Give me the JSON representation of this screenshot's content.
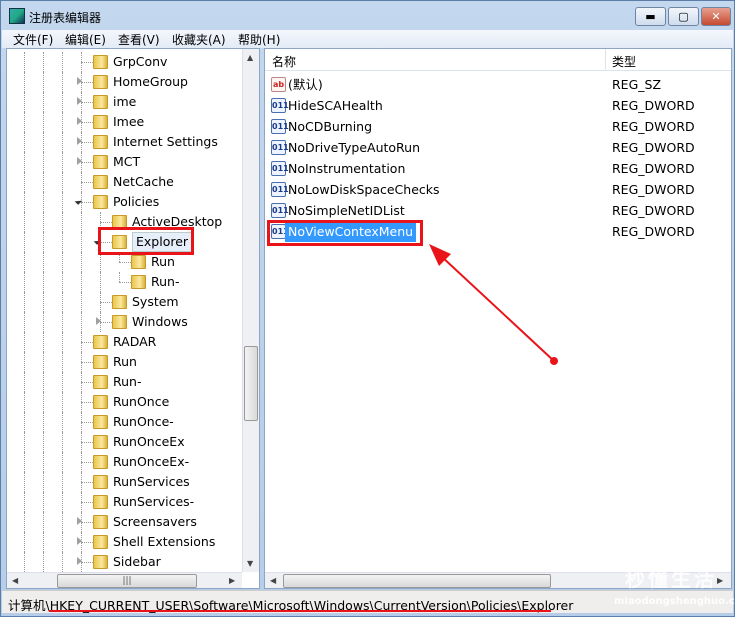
{
  "window": {
    "title": "注册表编辑器",
    "minimize": "▬",
    "maximize": "▢",
    "close": "✕"
  },
  "menu": [
    "文件(F)",
    "编辑(E)",
    "查看(V)",
    "收藏夹(A)",
    "帮助(H)"
  ],
  "tree": [
    {
      "label": "GrpConv",
      "level": 0,
      "expander": "none"
    },
    {
      "label": "HomeGroup",
      "level": 0,
      "expander": "collapsed"
    },
    {
      "label": "ime",
      "level": 0,
      "expander": "collapsed"
    },
    {
      "label": "Imee",
      "level": 0,
      "expander": "collapsed"
    },
    {
      "label": "Internet Settings",
      "level": 0,
      "expander": "collapsed"
    },
    {
      "label": "MCT",
      "level": 0,
      "expander": "collapsed"
    },
    {
      "label": "NetCache",
      "level": 0,
      "expander": "none"
    },
    {
      "label": "Policies",
      "level": 0,
      "expander": "expanded"
    },
    {
      "label": "ActiveDesktop",
      "level": 1,
      "expander": "none"
    },
    {
      "label": "Explorer",
      "level": 1,
      "expander": "expanded",
      "selected": true
    },
    {
      "label": "Run",
      "level": 2,
      "expander": "none"
    },
    {
      "label": "Run-",
      "level": 2,
      "expander": "none"
    },
    {
      "label": "System",
      "level": 1,
      "expander": "none"
    },
    {
      "label": "Windows",
      "level": 1,
      "expander": "collapsed"
    },
    {
      "label": "RADAR",
      "level": 0,
      "expander": "none"
    },
    {
      "label": "Run",
      "level": 0,
      "expander": "none"
    },
    {
      "label": "Run-",
      "level": 0,
      "expander": "none"
    },
    {
      "label": "RunOnce",
      "level": 0,
      "expander": "none"
    },
    {
      "label": "RunOnce-",
      "level": 0,
      "expander": "none"
    },
    {
      "label": "RunOnceEx",
      "level": 0,
      "expander": "none"
    },
    {
      "label": "RunOnceEx-",
      "level": 0,
      "expander": "none"
    },
    {
      "label": "RunServices",
      "level": 0,
      "expander": "none"
    },
    {
      "label": "RunServices-",
      "level": 0,
      "expander": "none"
    },
    {
      "label": "Screensavers",
      "level": 0,
      "expander": "collapsed"
    },
    {
      "label": "Shell Extensions",
      "level": 0,
      "expander": "collapsed"
    },
    {
      "label": "Sidebar",
      "level": 0,
      "expander": "collapsed"
    }
  ],
  "list": {
    "columns": {
      "name": "名称",
      "type": "类型"
    },
    "rows": [
      {
        "name": "(默认)",
        "type": "REG_SZ",
        "icon": "ab"
      },
      {
        "name": "HideSCAHealth",
        "type": "REG_DWORD",
        "icon": "binary"
      },
      {
        "name": "NoCDBurning",
        "type": "REG_DWORD",
        "icon": "binary"
      },
      {
        "name": "NoDriveTypeAutoRun",
        "type": "REG_DWORD",
        "icon": "binary"
      },
      {
        "name": "NoInstrumentation",
        "type": "REG_DWORD",
        "icon": "binary"
      },
      {
        "name": "NoLowDiskSpaceChecks",
        "type": "REG_DWORD",
        "icon": "binary"
      },
      {
        "name": "NoSimpleNetIDList",
        "type": "REG_DWORD",
        "icon": "binary"
      },
      {
        "name": "NoViewContexMenu",
        "type": "REG_DWORD",
        "icon": "binary",
        "selected": true
      }
    ]
  },
  "status": {
    "path": "计算机\\HKEY_CURRENT_USER\\Software\\Microsoft\\Windows\\CurrentVersion\\Policies\\Explorer"
  },
  "watermark": {
    "text": "秒懂生活",
    "url": "miaodongshenghuo.com"
  },
  "colors": {
    "highlight": "#e8141a",
    "selection": "#3399ff"
  }
}
